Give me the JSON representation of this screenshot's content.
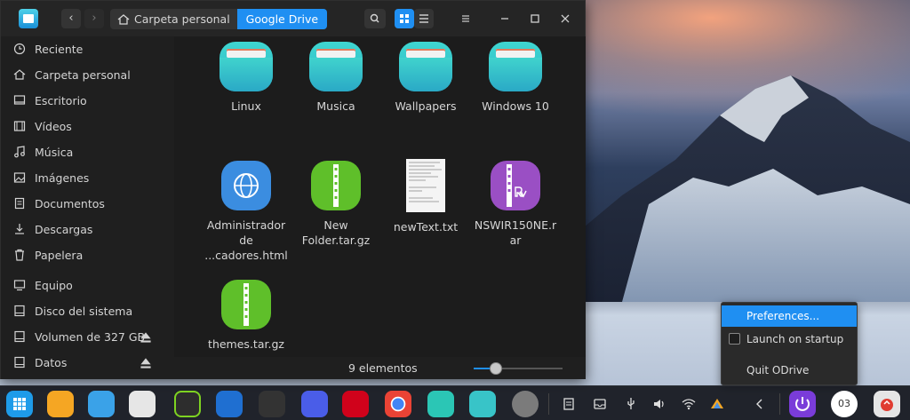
{
  "window": {
    "breadcrumb_home": "Carpeta personal",
    "breadcrumb_current": "Google Drive"
  },
  "sidebar": {
    "items": [
      {
        "label": "Reciente",
        "icon": "clock-icon"
      },
      {
        "label": "Carpeta personal",
        "icon": "home-icon"
      },
      {
        "label": "Escritorio",
        "icon": "desktop-icon"
      },
      {
        "label": "Vídeos",
        "icon": "video-icon"
      },
      {
        "label": "Música",
        "icon": "music-icon"
      },
      {
        "label": "Imágenes",
        "icon": "image-icon"
      },
      {
        "label": "Documentos",
        "icon": "document-icon"
      },
      {
        "label": "Descargas",
        "icon": "download-icon"
      },
      {
        "label": "Papelera",
        "icon": "trash-icon"
      },
      {
        "label": "Equipo",
        "icon": "computer-icon"
      },
      {
        "label": "Disco del sistema",
        "icon": "disk-icon"
      },
      {
        "label": "Volumen de 327 GB",
        "icon": "disk-icon"
      },
      {
        "label": "Datos",
        "icon": "disk-icon"
      }
    ]
  },
  "files": [
    {
      "name": "Linux",
      "type": "folder"
    },
    {
      "name": "Musica",
      "type": "folder"
    },
    {
      "name": "Wallpapers",
      "type": "folder"
    },
    {
      "name": "Windows 10",
      "type": "folder"
    },
    {
      "name_lines": [
        "Administrador",
        "de",
        "...cadores.html"
      ],
      "type": "html"
    },
    {
      "name_lines": [
        "New",
        "Folder.tar.gz"
      ],
      "type": "archive"
    },
    {
      "name": "newText.txt",
      "type": "text"
    },
    {
      "name_lines": [
        "NSWIR150NE.r",
        "ar"
      ],
      "type": "rar"
    },
    {
      "name": "themes.tar.gz",
      "type": "archive"
    }
  ],
  "status": {
    "count": "9 elementos",
    "zoom_level": 0.25
  },
  "context_menu": {
    "preferences": "Preferences...",
    "launch": "Launch on startup",
    "quit": "Quit ODrive"
  },
  "dock": {
    "clock_text": "03"
  },
  "colors": {
    "accent": "#1f8ff2",
    "folder": "#36c4cc",
    "archive_green": "#5fbf2a",
    "rar_purple": "#9a4fc4",
    "web_blue": "#3b8de0"
  }
}
